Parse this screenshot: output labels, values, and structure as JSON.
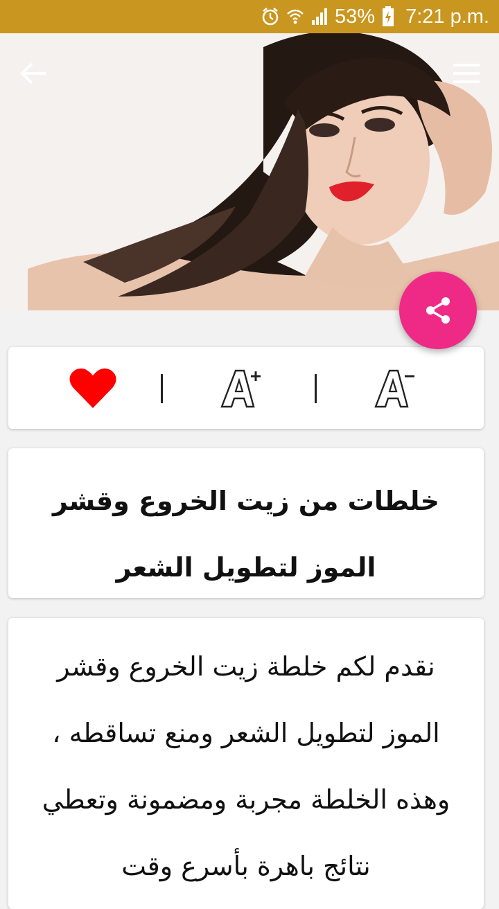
{
  "status_bar": {
    "battery_percent": "53%",
    "time": "7:21 p.m.",
    "icons": [
      "alarm-icon",
      "wifi-icon",
      "signal-icon",
      "battery-charging-icon"
    ]
  },
  "colors": {
    "status_bar": "#c9961f",
    "share_button": "#ee2a86",
    "heart": "#ff0000"
  },
  "header": {
    "back_icon": "arrow-left-icon",
    "menu_icon": "hamburger-menu-icon",
    "share_icon": "share-icon"
  },
  "toolbar": {
    "items": [
      {
        "icon": "heart-icon",
        "label": ""
      },
      {
        "icon": "font-increase-icon",
        "label": "A+"
      },
      {
        "icon": "font-decrease-icon",
        "label": "A-"
      }
    ]
  },
  "article": {
    "title": "خلطات من زيت الخروع وقشر الموز لتطويل الشعر",
    "body": "نقدم لكم خلطة زيت الخروع وقشر الموز لتطويل الشعر ومنع تساقطه ، وهذه الخلطة مجربة ومضمونة وتعطي نتائج باهرة بأسرع وقت"
  }
}
